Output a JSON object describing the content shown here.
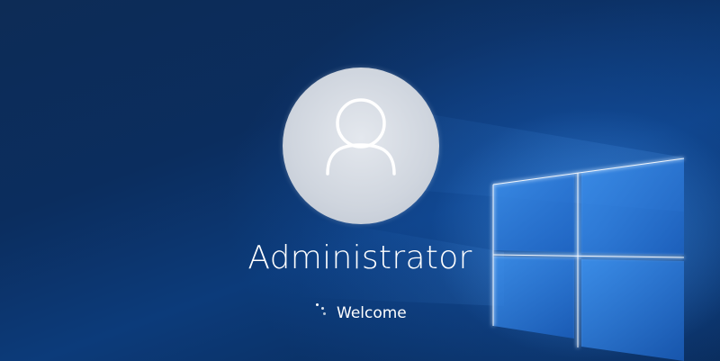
{
  "screen": {
    "type": "windows-lock-screen",
    "accent_color": "#2f8fff",
    "background_color": "#0b2d5e"
  },
  "user": {
    "name": "Administrator",
    "avatar_icon": "user-silhouette-icon"
  },
  "status": {
    "text": "Welcome",
    "spinner_icon": "loading-spinner-icon"
  }
}
